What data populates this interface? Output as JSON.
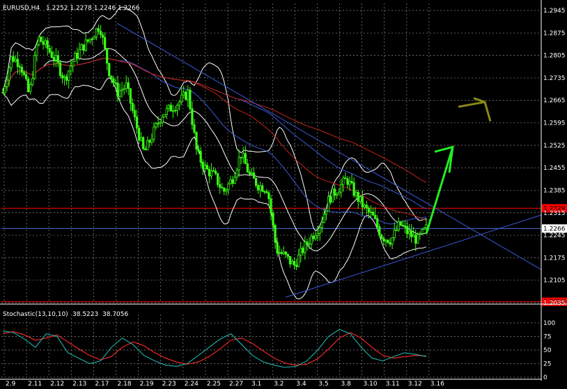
{
  "header": {
    "symbol": "EURUSD,H4",
    "ohlc": "1.2252 1.2278 1.2246 1.2266"
  },
  "stoch_header": "Stochastic(13,10,10)",
  "stoch_k": "38.5223",
  "stoch_d": "38.7056",
  "colors": {
    "background": "#000000",
    "grid": "#8a8a8a",
    "candles": "#39ff14",
    "bollinger": "#ffffff",
    "ma_blue": "#3b5bd9",
    "ma_red": "#c0241c",
    "trendline": "#3b5bd9",
    "level_line": "#ff0000",
    "current_price_line": "#4a6fd0",
    "stoch_main": "#20b2aa",
    "stoch_signal": "#ff2a2a",
    "arrow_up": "#22ee22",
    "arrow_olive": "#8a8a14"
  },
  "chart_data": [
    {
      "type": "candlestick",
      "title": "EURUSD,H4",
      "x_ticks": [
        "2.9",
        "2.11",
        "2.12",
        "2.13",
        "2.17",
        "2.18",
        "2.19",
        "2.23",
        "2.24",
        "2.25",
        "2.27",
        "3.1",
        "3.2",
        "3.4",
        "3.5",
        "3.8",
        "3.10",
        "3.11",
        "3.12",
        "3.16"
      ],
      "y_ticks": [
        1.2945,
        1.2875,
        1.2805,
        1.2735,
        1.2665,
        1.2595,
        1.2525,
        1.2455,
        1.2385,
        1.2315,
        1.2245,
        1.2175,
        1.2105,
        1.2035
      ],
      "ylim": [
        1.2035,
        1.2945
      ],
      "grid": true,
      "current_price": 1.2266,
      "level_lines": [
        1.2329,
        1.2038
      ],
      "level_labels": [
        "1.2329",
        "1.2038"
      ],
      "current_price_label": "1.2266",
      "close_path": [
        1.269,
        1.28,
        1.278,
        1.268,
        1.286,
        1.283,
        1.279,
        1.273,
        1.279,
        1.283,
        1.286,
        1.29,
        1.276,
        1.269,
        1.271,
        1.26,
        1.25,
        1.256,
        1.262,
        1.264,
        1.266,
        1.269,
        1.25,
        1.245,
        1.243,
        1.238,
        1.242,
        1.25,
        1.243,
        1.24,
        1.239,
        1.22,
        1.218,
        1.215,
        1.22,
        1.224,
        1.228,
        1.236,
        1.239,
        1.242,
        1.237,
        1.233,
        1.23,
        1.224,
        1.223,
        1.228,
        1.225,
        1.223,
        1.2266
      ]
    },
    {
      "type": "line",
      "title": "Stochastic(13,10,10)",
      "ylim": [
        0,
        100
      ],
      "y_ticks": [
        100,
        75,
        50,
        25,
        0
      ],
      "series": [
        {
          "name": "38.5223",
          "values": [
            85,
            82,
            70,
            55,
            80,
            75,
            45,
            35,
            25,
            30,
            55,
            72,
            60,
            40,
            30,
            22,
            20,
            25,
            40,
            55,
            70,
            80,
            60,
            40,
            28,
            22,
            18,
            20,
            30,
            50,
            75,
            88,
            80,
            55,
            35,
            30,
            38,
            45,
            42,
            38
          ]
        },
        {
          "name": "38.7056",
          "values": [
            80,
            84,
            78,
            68,
            72,
            78,
            65,
            52,
            40,
            32,
            38,
            55,
            65,
            58,
            45,
            35,
            28,
            24,
            28,
            38,
            52,
            68,
            72,
            62,
            48,
            35,
            26,
            22,
            24,
            34,
            52,
            72,
            82,
            72,
            55,
            40,
            35,
            38,
            40,
            39
          ]
        }
      ]
    }
  ]
}
